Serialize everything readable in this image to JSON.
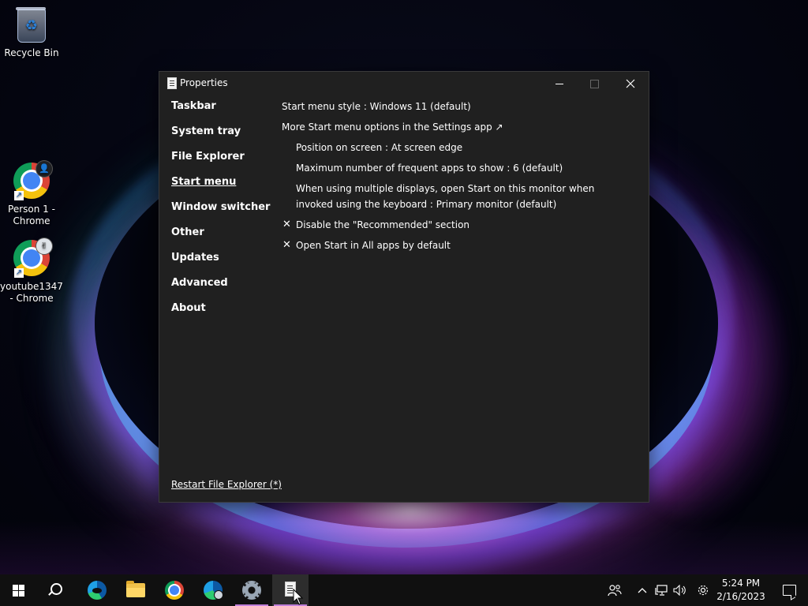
{
  "desktop": {
    "icons": [
      {
        "label": "Recycle Bin"
      },
      {
        "label": "Person 1 - Chrome"
      },
      {
        "label": "youtube1347 - Chrome"
      }
    ]
  },
  "window": {
    "title": "Properties",
    "buttons": {
      "minimize": "minimize-icon",
      "maximize": "maximize-icon",
      "close": "close-icon"
    },
    "nav": [
      {
        "label": "Taskbar",
        "active": false
      },
      {
        "label": "System tray",
        "active": false
      },
      {
        "label": "File Explorer",
        "active": false
      },
      {
        "label": "Start menu",
        "active": true
      },
      {
        "label": "Window switcher",
        "active": false
      },
      {
        "label": "Other",
        "active": false
      },
      {
        "label": "Updates",
        "active": false
      },
      {
        "label": "Advanced",
        "active": false
      },
      {
        "label": "About",
        "active": false
      }
    ],
    "options": [
      {
        "text": "Start menu style : Windows 11 (default)"
      },
      {
        "text": "More Start menu options in the Settings app ↗"
      },
      {
        "text": "Position on screen : At screen edge"
      },
      {
        "text": "Maximum number of frequent apps to show : 6 (default)"
      },
      {
        "text": "When using multiple displays, open Start on this monitor when invoked using the keyboard : Primary monitor (default)"
      },
      {
        "text": "Disable the \"Recommended\" section",
        "checked": true
      },
      {
        "text": "Open Start in All apps by default",
        "checked": true
      }
    ],
    "check_mark": "✕",
    "restart_link": "Restart File Explorer (*)"
  },
  "taskbar": {
    "apps": [
      "start-icon",
      "search-icon",
      "edge-icon",
      "file-explorer-icon",
      "chrome-icon",
      "edge-beta-icon",
      "settings-icon",
      "properties-icon"
    ],
    "active_app": "properties-icon",
    "active_underline_color": "#c07fd8",
    "tray_icons": [
      "people-icon",
      "chevron-up-icon",
      "network-icon",
      "volume-icon",
      "gear-icon"
    ],
    "time": "5:24 PM",
    "date": "2/16/2023"
  }
}
